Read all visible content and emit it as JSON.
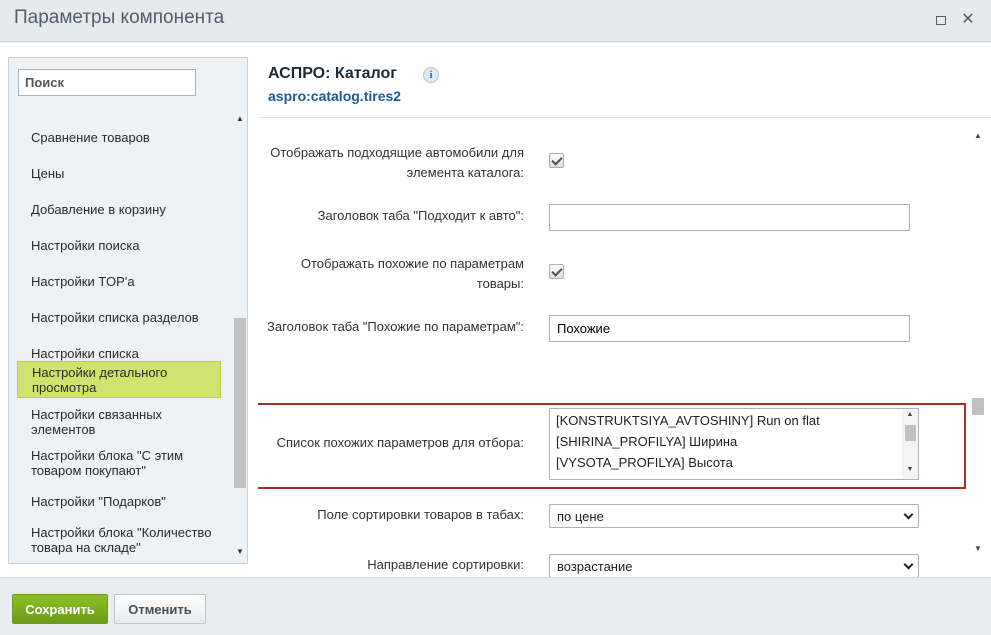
{
  "window": {
    "title": "Параметры компонента",
    "maximize_icon": "maximize-icon",
    "close_icon": "close-icon",
    "close_glyph": "✕"
  },
  "sidebar": {
    "search_placeholder": "Поиск",
    "items": [
      {
        "label": "Сравнение товаров"
      },
      {
        "label": "Цены"
      },
      {
        "label": "Добавление в корзину"
      },
      {
        "label": "Настройки поиска"
      },
      {
        "label": "Настройки TOP'а"
      },
      {
        "label": "Настройки списка разделов"
      },
      {
        "label": "Настройки списка"
      },
      {
        "label": "Настройки детального просмотра",
        "active": true
      },
      {
        "label": "Настройки связанных элементов"
      },
      {
        "label": "Настройки блока \"С этим товаром покупают\""
      },
      {
        "label": "Настройки \"Подарков\""
      },
      {
        "label": "Настройки блока \"Количество товара на складе\""
      }
    ],
    "active_color": "#cfe36e"
  },
  "component": {
    "title": "АСПРО: Каталог",
    "info_glyph": "i",
    "code": "aspro:catalog.tires2"
  },
  "form": {
    "show_cars_label": "Отображать подходящие автомобили для элемента каталога:",
    "show_cars_checked": true,
    "cars_tab_label": "Заголовок таба \"Подходит к авто\":",
    "cars_tab_value": "",
    "show_similar_label": "Отображать похожие по параметрам товары:",
    "show_similar_checked": true,
    "similar_tab_label": "Заголовок таба \"Похожие по параметрам\":",
    "similar_tab_value": "Похожие",
    "similar_list_label": "Список похожих параметров для отбора:",
    "similar_list_options": [
      "[KONSTRUKTSIYA_AVTOSHINY] Run on flat",
      "[SHIRINA_PROFILYA] Ширина",
      "[VYSOTA_PROFILYA] Высота"
    ],
    "sort_field_label": "Поле сортировки товаров в табах:",
    "sort_field_value": "по цене",
    "sort_dir_label": "Направление сортировки:",
    "sort_dir_value": "возрастание",
    "highlight_color": "#a03129"
  },
  "footer": {
    "save_label": "Сохранить",
    "cancel_label": "Отменить",
    "save_color": "#7aaa1d"
  }
}
